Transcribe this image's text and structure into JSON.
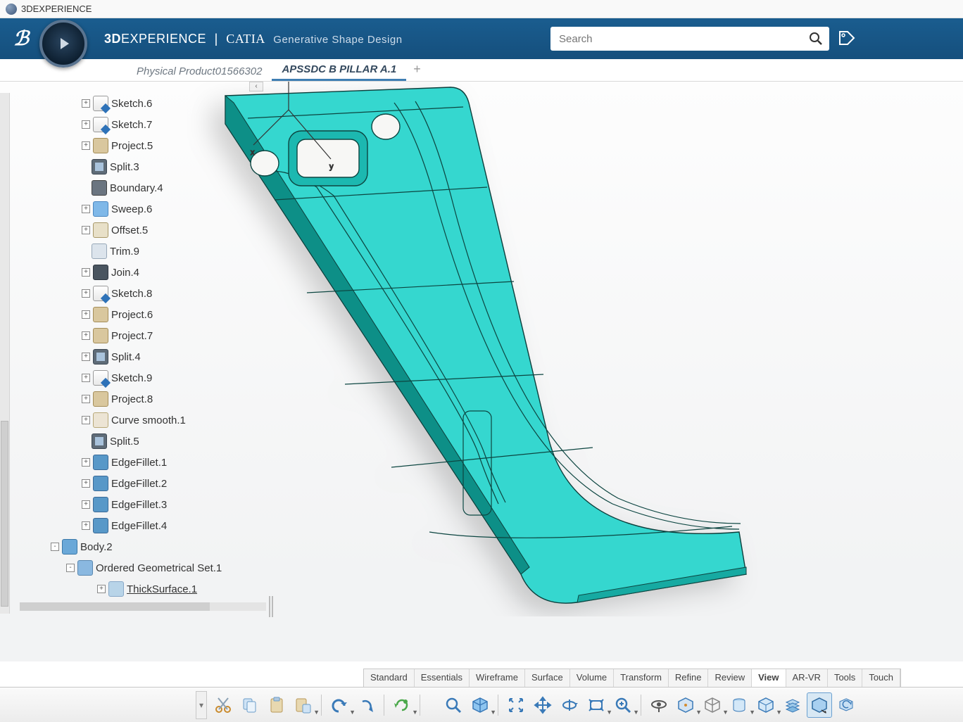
{
  "window_title": "3DEXPERIENCE",
  "brand": {
    "bold": "3D",
    "rest": "EXPERIENCE",
    "sep": "|",
    "app": "CATIA",
    "workbench": "Generative Shape Design"
  },
  "search": {
    "placeholder": "Search"
  },
  "tabs": [
    {
      "label": "Physical Product01566302",
      "active": false
    },
    {
      "label": "APSSDC B PILLAR A.1",
      "active": true
    }
  ],
  "tree": [
    {
      "indent": 2,
      "exp": "+",
      "icon": "fi-sketch",
      "label": "Sketch.6"
    },
    {
      "indent": 2,
      "exp": "+",
      "icon": "fi-sketch",
      "label": "Sketch.7"
    },
    {
      "indent": 2,
      "exp": "+",
      "icon": "fi-project",
      "label": "Project.5"
    },
    {
      "indent": 2,
      "exp": "",
      "icon": "fi-split",
      "label": "Split.3"
    },
    {
      "indent": 2,
      "exp": "",
      "icon": "fi-boundary",
      "label": "Boundary.4"
    },
    {
      "indent": 2,
      "exp": "+",
      "icon": "fi-sweep",
      "label": "Sweep.6"
    },
    {
      "indent": 2,
      "exp": "+",
      "icon": "fi-offset",
      "label": "Offset.5"
    },
    {
      "indent": 2,
      "exp": "",
      "icon": "fi-trim",
      "label": "Trim.9"
    },
    {
      "indent": 2,
      "exp": "+",
      "icon": "fi-join",
      "label": "Join.4"
    },
    {
      "indent": 2,
      "exp": "+",
      "icon": "fi-sketch",
      "label": "Sketch.8"
    },
    {
      "indent": 2,
      "exp": "+",
      "icon": "fi-project",
      "label": "Project.6"
    },
    {
      "indent": 2,
      "exp": "+",
      "icon": "fi-project",
      "label": "Project.7"
    },
    {
      "indent": 2,
      "exp": "+",
      "icon": "fi-split",
      "label": "Split.4"
    },
    {
      "indent": 2,
      "exp": "+",
      "icon": "fi-sketch",
      "label": "Sketch.9"
    },
    {
      "indent": 2,
      "exp": "+",
      "icon": "fi-project",
      "label": "Project.8"
    },
    {
      "indent": 2,
      "exp": "+",
      "icon": "fi-curve",
      "label": "Curve smooth.1"
    },
    {
      "indent": 2,
      "exp": "",
      "icon": "fi-split",
      "label": "Split.5"
    },
    {
      "indent": 2,
      "exp": "+",
      "icon": "fi-fillet",
      "label": "EdgeFillet.1"
    },
    {
      "indent": 2,
      "exp": "+",
      "icon": "fi-fillet",
      "label": "EdgeFillet.2"
    },
    {
      "indent": 2,
      "exp": "+",
      "icon": "fi-fillet",
      "label": "EdgeFillet.3"
    },
    {
      "indent": 2,
      "exp": "+",
      "icon": "fi-fillet",
      "label": "EdgeFillet.4"
    },
    {
      "indent": 0,
      "exp": "-",
      "icon": "fi-body",
      "label": "Body.2"
    },
    {
      "indent": 1,
      "exp": "-",
      "icon": "fi-ogs",
      "label": "Ordered Geometrical Set.1"
    },
    {
      "indent": 2,
      "exp": "+",
      "icon": "fi-thick",
      "label": "ThickSurface.1",
      "underline": true,
      "extra_indent": true
    }
  ],
  "ribbon_tabs": [
    "Standard",
    "Essentials",
    "Wireframe",
    "Surface",
    "Volume",
    "Transform",
    "Refine",
    "Review",
    "View",
    "AR-VR",
    "Tools",
    "Touch"
  ],
  "ribbon_active": "View",
  "toolbar_groups": {
    "edit": [
      "cut",
      "copy",
      "paste",
      "paste-special"
    ],
    "undo": [
      "undo",
      "redo"
    ],
    "update": [
      "update"
    ],
    "view": [
      "zoom-fit",
      "cube",
      "fit-all",
      "pan",
      "rotate",
      "look-at",
      "zoom",
      "fly",
      "walk",
      "render-mode",
      "view-cube",
      "view-front",
      "layers",
      "perspective",
      "capture"
    ]
  }
}
